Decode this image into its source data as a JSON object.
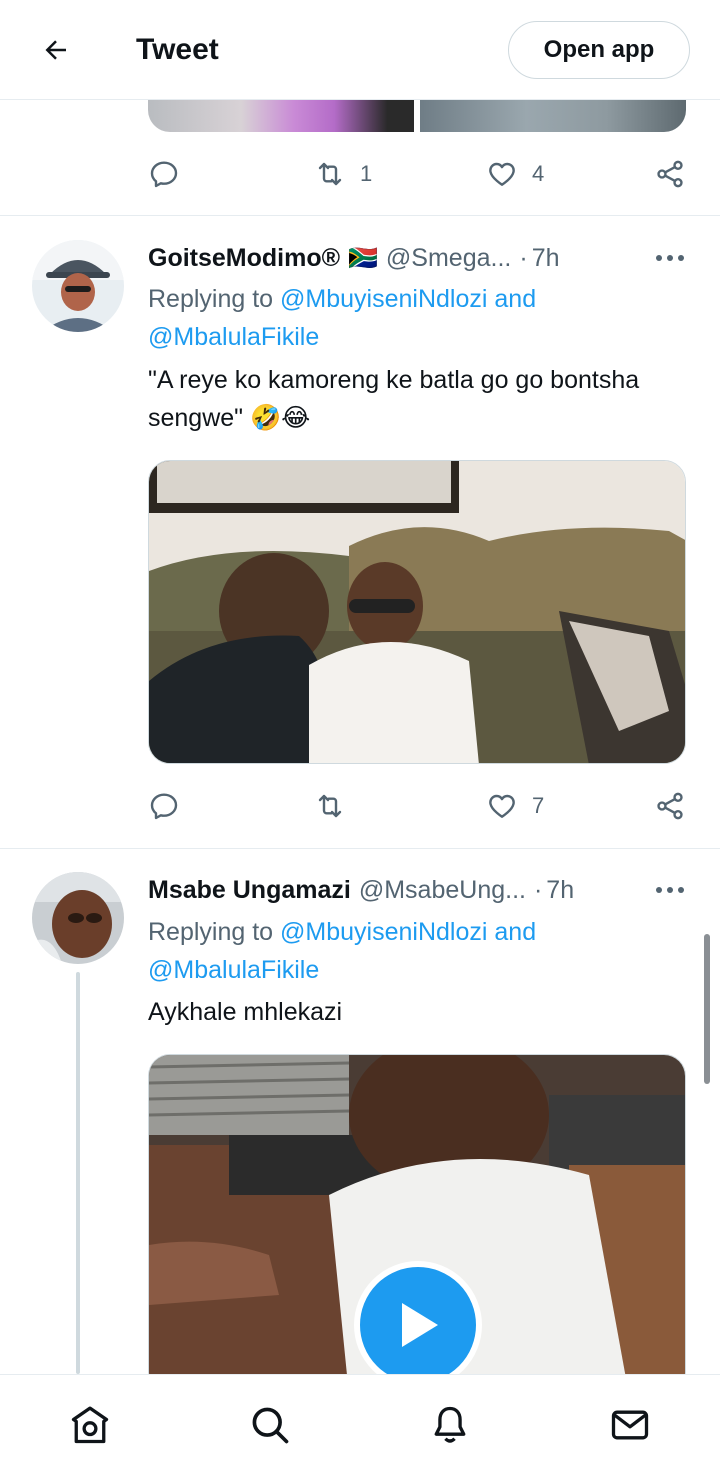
{
  "header": {
    "title": "Tweet",
    "open_app_label": "Open app"
  },
  "top_tweet_actions": {
    "reply_count": "",
    "retweet_count": "1",
    "like_count": "4"
  },
  "tweets": [
    {
      "name": "GoitseModimo®",
      "flag": "🇿🇦",
      "handle": "@Smega...",
      "time": "7h",
      "replying_prefix": "Replying to",
      "mentions": [
        "@MbuyiseniNdlozi",
        "@MbalulaFikile"
      ],
      "mention_join": "and",
      "text": "\"A reye ko kamoreng ke batla go go bontsha sengwe\" 🤣😂",
      "like_count": "7"
    },
    {
      "name": "Msabe Ungamazi",
      "handle": "@MsabeUng...",
      "time": "7h",
      "replying_prefix": "Replying to",
      "mentions": [
        "@MbuyiseniNdlozi",
        "@MbalulaFikile"
      ],
      "mention_join": "and",
      "text": "Aykhale mhlekazi"
    }
  ],
  "nav": {
    "items": [
      "home-icon",
      "search-icon",
      "notifications-icon",
      "messages-icon"
    ]
  },
  "colors": {
    "accent": "#1d9bf0",
    "secondary_text": "#536471",
    "divider": "#e6ecf0"
  }
}
